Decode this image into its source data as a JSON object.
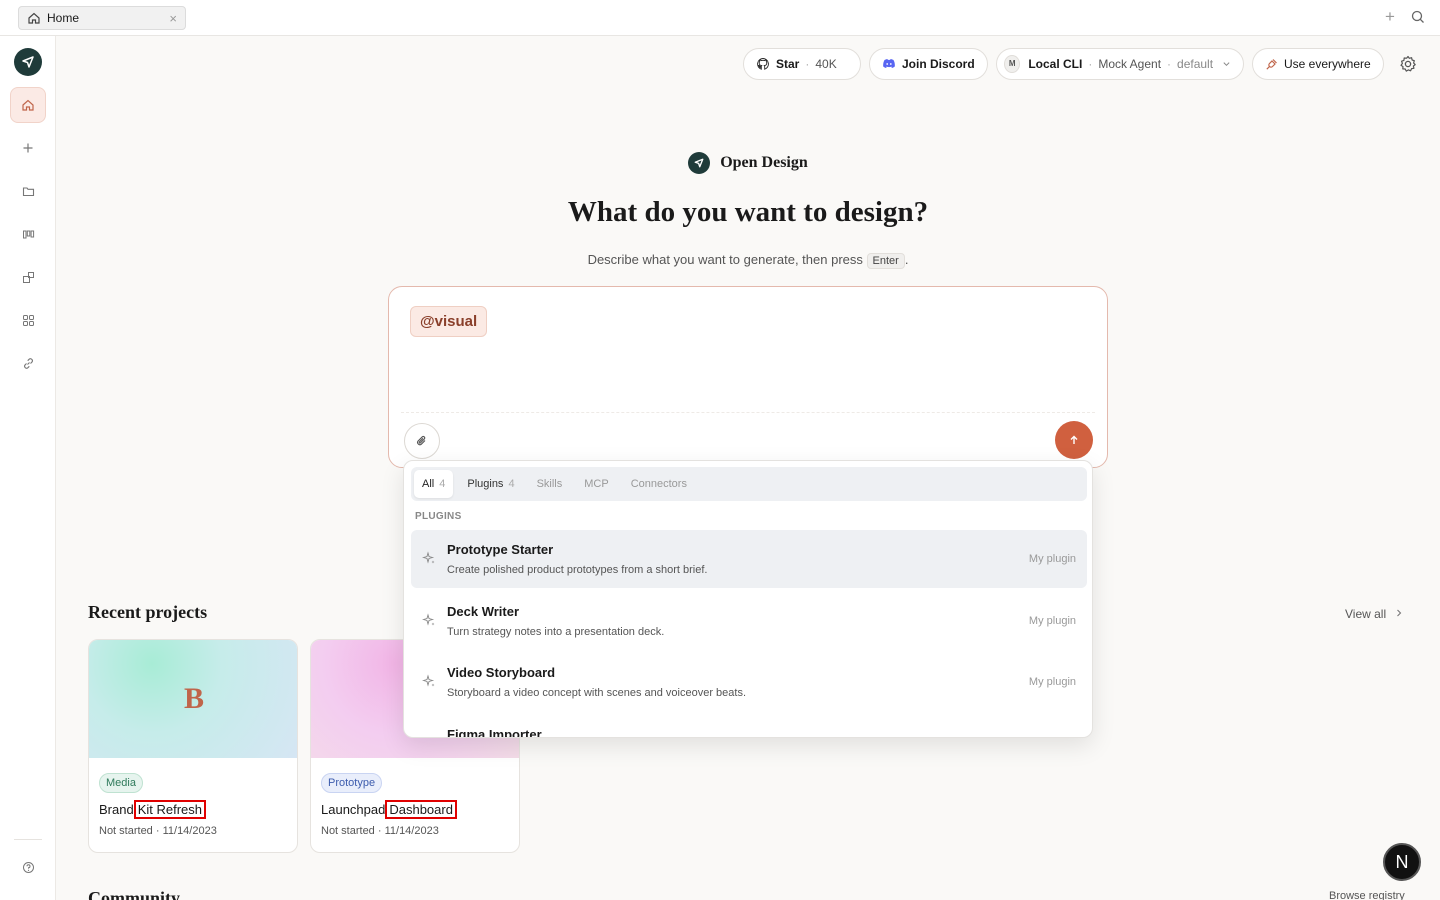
{
  "tabbar": {
    "tab_label": "Home",
    "close_glyph": "×",
    "new_tab_glyph": "+"
  },
  "header": {
    "star": {
      "label": "Star",
      "count": "40K"
    },
    "discord_label": "Join Discord",
    "agent": {
      "badge": "M",
      "cli_label": "Local CLI",
      "agent_name": "Mock Agent",
      "profile": "default"
    },
    "use_everywhere_label": "Use everywhere"
  },
  "hero": {
    "brand": "Open Design",
    "title": "What do you want to design?",
    "subtitle_prefix": "Describe what you want to generate, then press",
    "kbd": "Enter",
    "subtitle_suffix": "."
  },
  "composer": {
    "mention_chip": "@visual"
  },
  "dropdown": {
    "tabs": [
      {
        "label": "All",
        "count": "4"
      },
      {
        "label": "Plugins",
        "count": "4"
      },
      {
        "label": "Skills"
      },
      {
        "label": "MCP"
      },
      {
        "label": "Connectors"
      }
    ],
    "section": "PLUGINS",
    "items": [
      {
        "title": "Prototype Starter",
        "desc": "Create polished product prototypes from a short brief.",
        "meta": "My plugin"
      },
      {
        "title": "Deck Writer",
        "desc": "Turn strategy notes into a presentation deck.",
        "meta": "My plugin"
      },
      {
        "title": "Video Storyboard",
        "desc": "Storyboard a video concept with scenes and voiceover beats.",
        "meta": "My plugin"
      },
      {
        "title": "Figma Importer"
      }
    ]
  },
  "recent": {
    "title": "Recent projects",
    "view_all": "View all",
    "projects": [
      {
        "thumb_letter": "B",
        "badge": "Media",
        "name_a": "Brand",
        "name_b": "Kit Refresh",
        "status": "Not started",
        "date": "11/14/2023"
      },
      {
        "badge": "Prototype",
        "name_a": "Launchpad",
        "name_b": "Dashboard",
        "status": "Not started",
        "date": "11/14/2023"
      }
    ]
  },
  "community": {
    "title": "Community",
    "browse": "Browse registry"
  },
  "fab_label": "N",
  "colors": {
    "accent": "#d0603f",
    "brand_dark": "#1f3b3a"
  }
}
